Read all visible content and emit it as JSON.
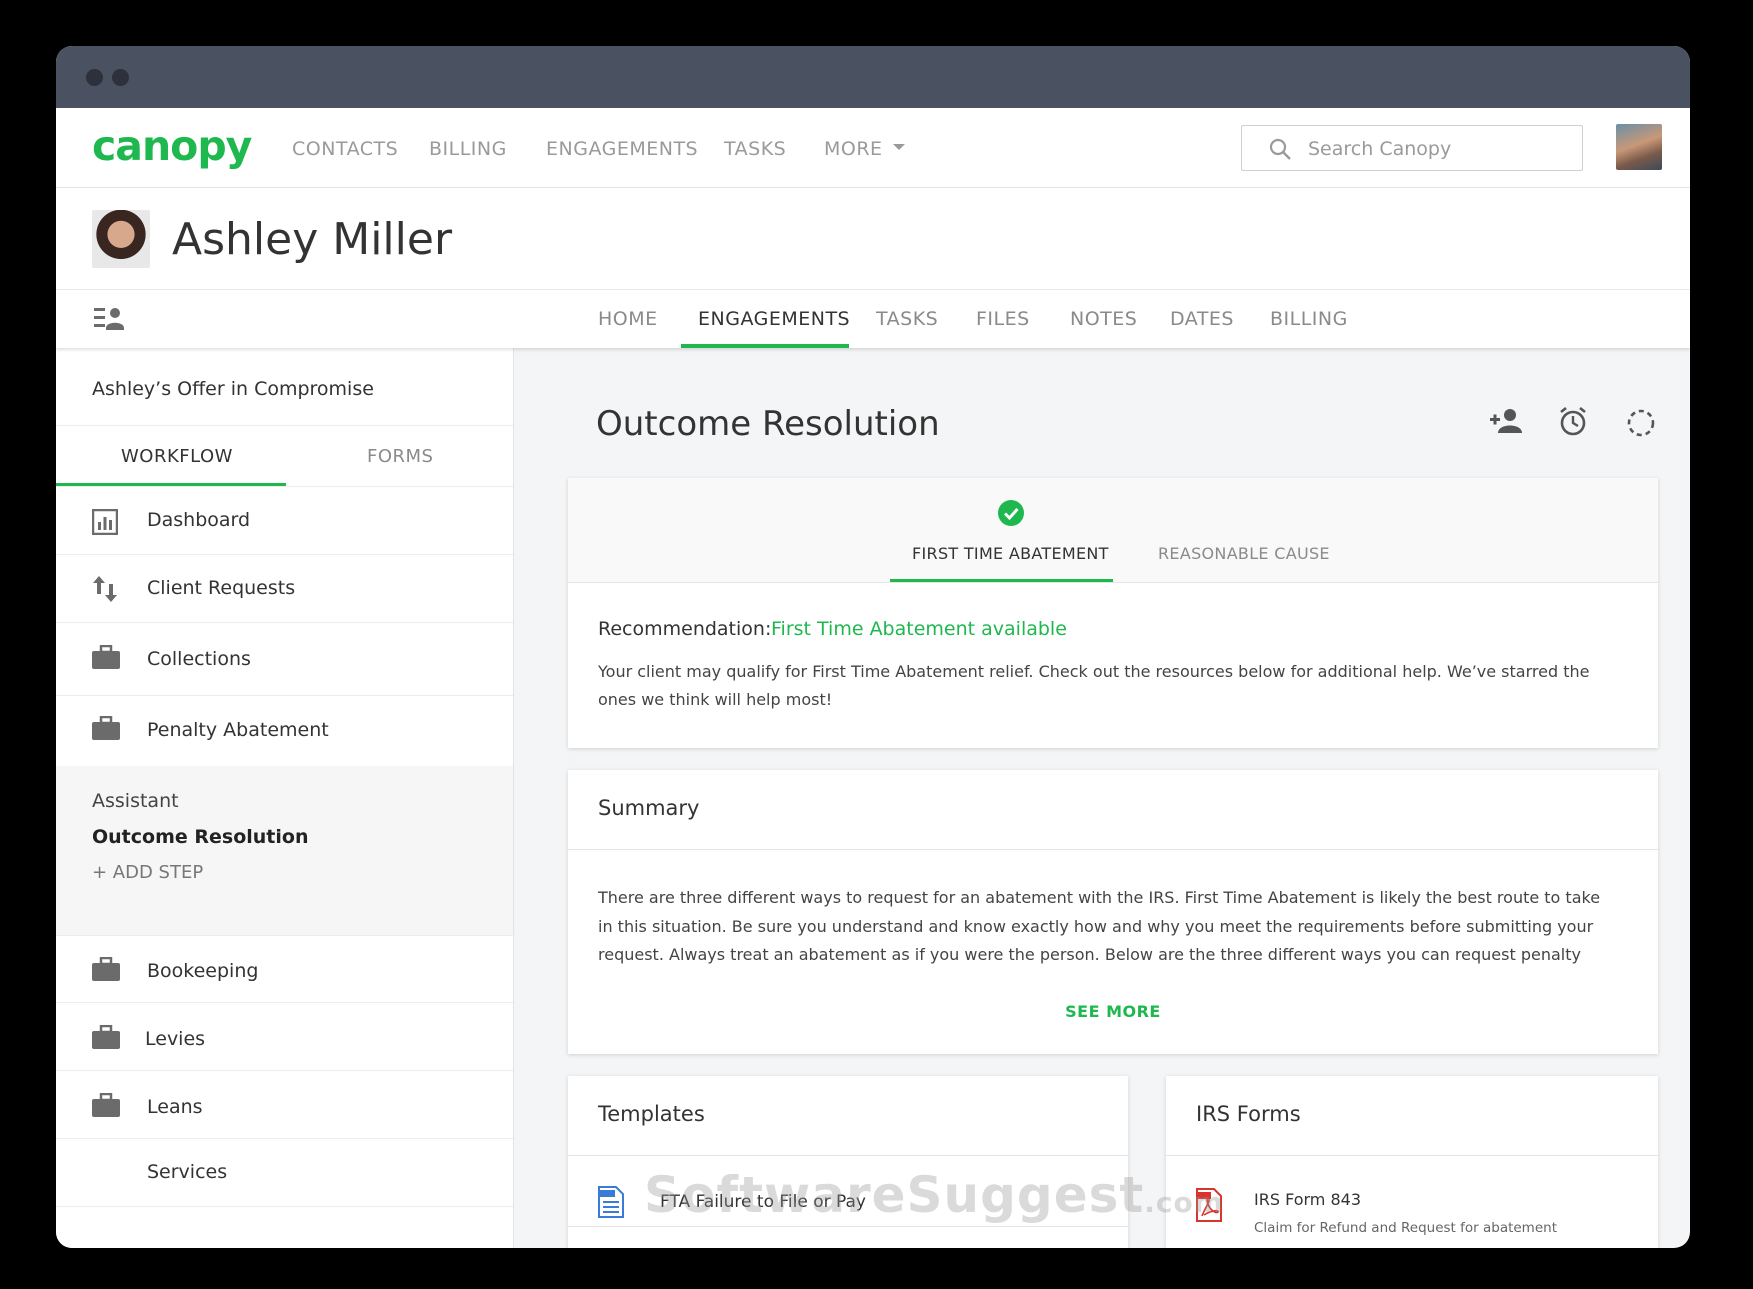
{
  "app": {
    "logo": "canopy",
    "nav": [
      "CONTACTS",
      "BILLING",
      "ENGAGEMENTS",
      "TASKS",
      "MORE"
    ],
    "search_placeholder": "Search Canopy"
  },
  "client": {
    "name": "Ashley Miller",
    "tabs": [
      "HOME",
      "ENGAGEMENTS",
      "TASKS",
      "FILES",
      "NOTES",
      "DATES",
      "BILLING"
    ],
    "active_tab": "ENGAGEMENTS"
  },
  "sidebar": {
    "engagement_title": "Ashley’s Offer in Compromise",
    "tabs": [
      "WORKFLOW",
      "FORMS"
    ],
    "items": [
      {
        "label": "Dashboard",
        "icon": "chart-icon"
      },
      {
        "label": "Client Requests",
        "icon": "swap-arrows-icon"
      },
      {
        "label": "Collections",
        "icon": "briefcase-icon"
      },
      {
        "label": "Penalty Abatement",
        "icon": "briefcase-icon"
      }
    ],
    "sub_items": [
      "Assistant",
      "Outcome Resolution"
    ],
    "add_step": "+ ADD STEP",
    "items_after": [
      {
        "label": "Bookeeping",
        "icon": "briefcase-icon"
      },
      {
        "label": "Levies",
        "icon": "briefcase-icon"
      },
      {
        "label": "Leans",
        "icon": "briefcase-icon"
      },
      {
        "label": "Services",
        "icon": ""
      }
    ]
  },
  "main": {
    "title": "Outcome Resolution",
    "tabs": [
      "FIRST TIME ABATEMENT",
      "REASONABLE CAUSE"
    ],
    "recommendation_label": "Recommendation:",
    "recommendation_value": "First Time Abatement available",
    "recommendation_body": "Your client may qualify for First Time Abatement relief. Check out the resources below for additional help.  We’ve starred the ones we think will help most!",
    "summary_title": "Summary",
    "summary_body": "There are three different ways to request for an abatement with the IRS. First Time Abatement is likely the best route to take in this situation. Be sure you understand and know exactly how and why you meet the requirements before submitting your request. Always treat an abatement as if you were the person.  Below are the three different ways you can request penalty",
    "see_more": "SEE MORE",
    "templates_title": "Templates",
    "template_item": "FTA Failure to File or Pay",
    "irs_title": "IRS Forms",
    "irs_item": "IRS Form 843",
    "irs_item_sub": "Claim for Refund and Request for abatement"
  },
  "watermark": {
    "main": "SoftwareSuggest",
    "suffix": ".com"
  },
  "colors": {
    "accent": "#1fb84f",
    "titlebar": "#4a5261"
  }
}
